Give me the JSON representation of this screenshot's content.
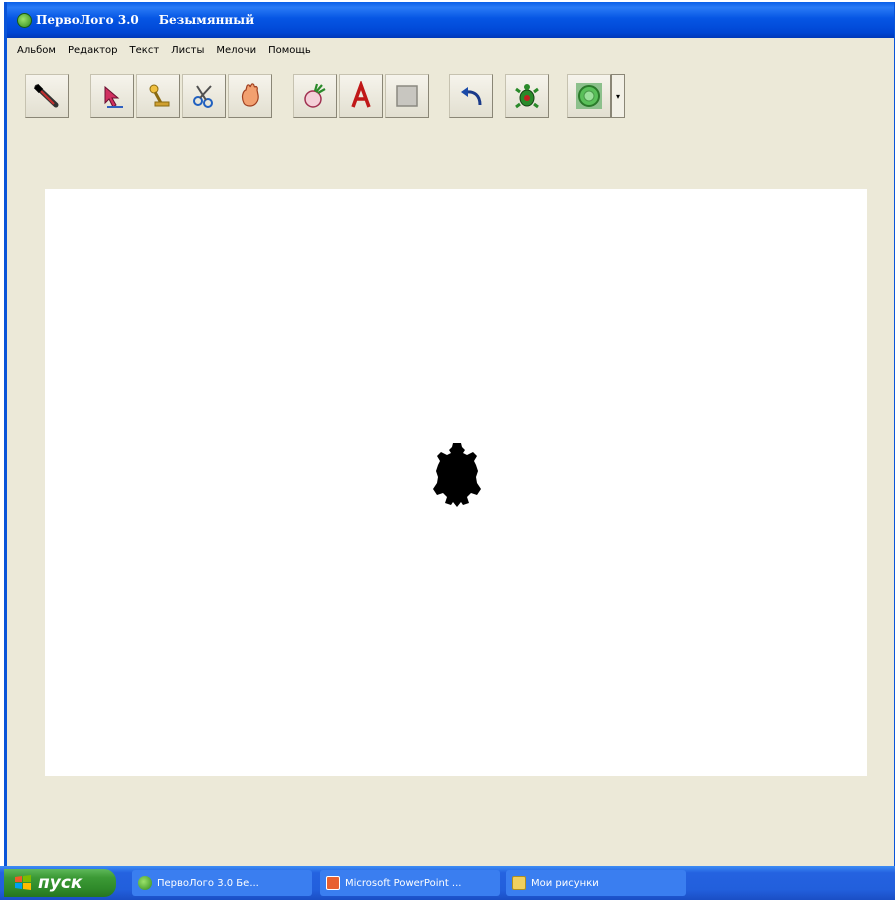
{
  "window": {
    "app_title": "ПервоЛого 3.0",
    "doc_title": "Безымянный"
  },
  "menu": [
    "Альбом",
    "Редактор",
    "Текст",
    "Листы",
    "Мелочи",
    "Помощь"
  ],
  "toolbar": {
    "tools": [
      {
        "name": "brush-tool",
        "icon": "brush-icon"
      },
      {
        "name": "select-tool",
        "icon": "arrow-cursor-icon"
      },
      {
        "name": "stamp-tool",
        "icon": "stamp-icon"
      },
      {
        "name": "scissors-tool",
        "icon": "scissors-icon"
      },
      {
        "name": "hand-tool",
        "icon": "hand-icon"
      },
      {
        "name": "new-turtle-tool",
        "icon": "turtle-hatch-icon"
      },
      {
        "name": "text-tool",
        "icon": "letter-a-icon"
      },
      {
        "name": "rectangle-tool",
        "icon": "square-icon"
      },
      {
        "name": "undo-tool",
        "icon": "undo-arrow-icon"
      },
      {
        "name": "turtle-tool",
        "icon": "turtle-icon"
      },
      {
        "name": "color-tool",
        "icon": "color-circle-icon"
      }
    ]
  },
  "taskbar": {
    "start_label": "пуск",
    "tasks": [
      {
        "label": "ПервоЛого 3.0    Бе..."
      },
      {
        "label": "Microsoft PowerPoint ..."
      },
      {
        "label": "Мои рисунки"
      }
    ]
  },
  "colors": {
    "title_bar": "#0656e4",
    "window_bg": "#ece9d8",
    "canvas": "#ffffff",
    "turtle": "#000000",
    "taskbar": "#225fdc",
    "start_button": "#3c9a36"
  }
}
